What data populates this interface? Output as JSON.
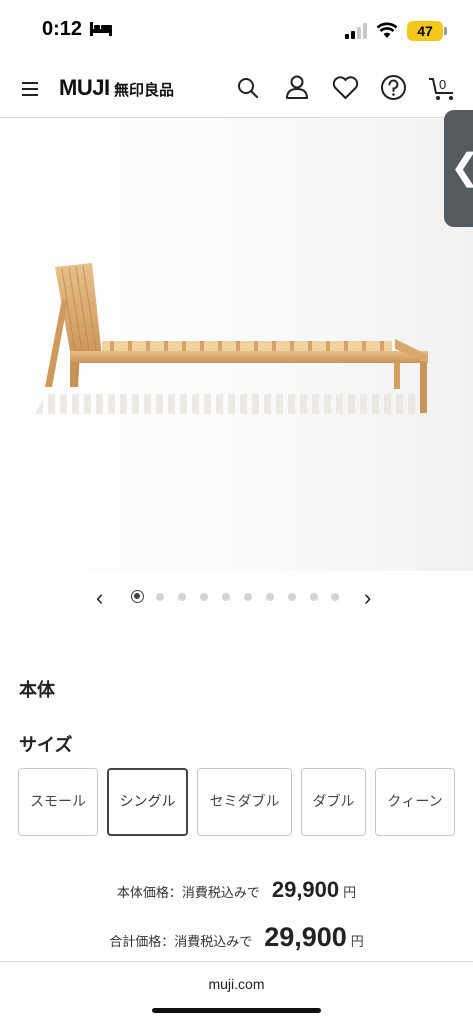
{
  "status_bar": {
    "time": "0:12",
    "battery": "47"
  },
  "header": {
    "logo": "MUJI",
    "logo_jp": "無印良品",
    "cart_count": "0"
  },
  "side_tab": {
    "glyph": "❮"
  },
  "carousel": {
    "prev": "‹",
    "next": "›",
    "total_dots": 10,
    "active_index": 0
  },
  "product": {
    "section_label": "本体",
    "size_label": "サイズ"
  },
  "sizes": [
    {
      "label": "スモール",
      "selected": false
    },
    {
      "label": "シングル",
      "selected": true
    },
    {
      "label": "セミダブル",
      "selected": false
    },
    {
      "label": "ダブル",
      "selected": false
    },
    {
      "label": "クィーン",
      "selected": false
    }
  ],
  "pricing": {
    "body_price_label": "本体価格：消費税込みで",
    "body_price": "29,900",
    "total_price_label": "合計価格：消費税込みで",
    "total_price": "29,900",
    "currency": "円"
  },
  "footer": {
    "url": "muji.com"
  },
  "colors": {
    "accent_battery": "#f2c81c",
    "text": "#222222"
  },
  "icons": [
    "bed-icon",
    "signal-icon",
    "wifi-icon",
    "menu-icon",
    "search-icon",
    "account-icon",
    "heart-icon",
    "help-icon",
    "cart-icon"
  ]
}
